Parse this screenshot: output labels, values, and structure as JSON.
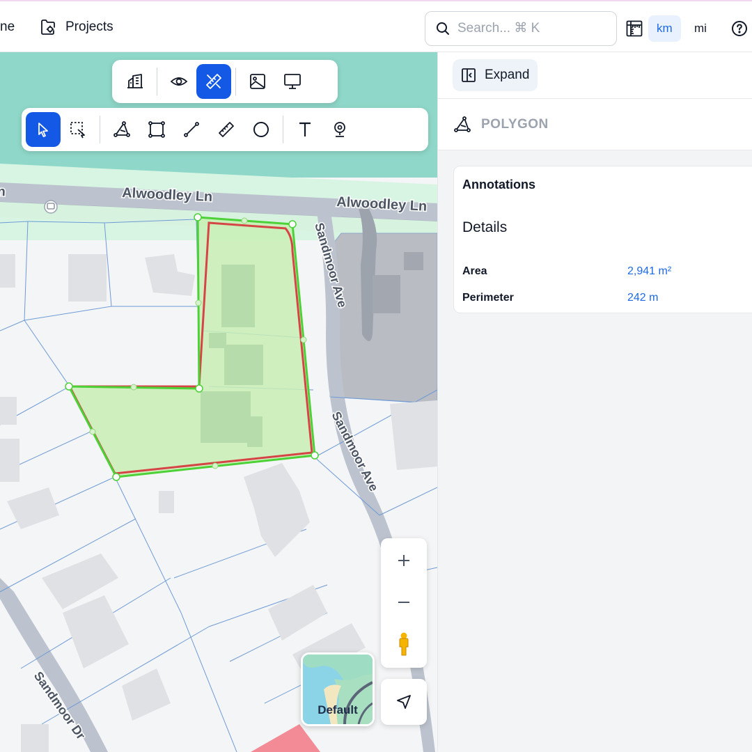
{
  "nav": {
    "home_label": "ne",
    "projects_label": "Projects"
  },
  "search": {
    "placeholder": "Search... ⌘ K"
  },
  "units": {
    "km": "km",
    "mi": "mi",
    "selected": "km"
  },
  "toolbar_top": {
    "buttons": [
      "building-icon",
      "eye-icon",
      "ruler-pencil-icon",
      "image-icon",
      "monitor-icon"
    ],
    "active": "ruler-pencil-icon"
  },
  "toolbar_draw": {
    "buttons": [
      "pointer-icon",
      "select-box-icon",
      "polygon-icon",
      "rectangle-icon",
      "line-icon",
      "ruler-icon",
      "circle-icon",
      "text-icon",
      "marker-icon"
    ],
    "active": "pointer-icon"
  },
  "map": {
    "street_labels": {
      "alwoodley_1": "Alwoodley Ln",
      "alwoodley_2": "Alwoodley Ln",
      "sandmoor_ave_1": "Sandmoor Ave",
      "sandmoor_ave_2": "Sandmoor Ave",
      "sandmoor_dr": "Sandmoor Dr"
    },
    "basemap_label": "Default",
    "colors": {
      "green_area": "#8fd8c9",
      "road": "#bcc3ce",
      "polygon_stroke": "#4cd137",
      "polygon_fill": "#c8efb4",
      "parcel_outline": "#d64545",
      "accent": "#1459e6"
    }
  },
  "panel": {
    "expand_label": "Expand",
    "type_label": "POLYGON",
    "card_title": "Annotations",
    "card_subtitle": "Details",
    "properties": [
      {
        "key": "Area",
        "value": "2,941 m²"
      },
      {
        "key": "Perimeter",
        "value": "242 m"
      }
    ]
  }
}
